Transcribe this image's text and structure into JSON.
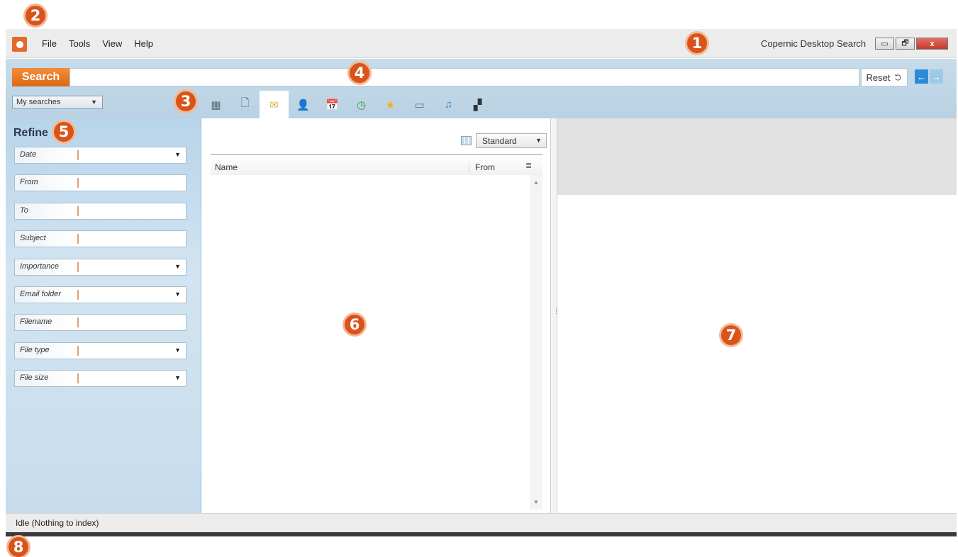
{
  "callouts": [
    "1",
    "2",
    "3",
    "4",
    "5",
    "6",
    "7",
    "8"
  ],
  "window": {
    "title": "Copernic Desktop Search",
    "minimize_glyph": "▭",
    "restore_glyph": "🗗",
    "close_glyph": "x",
    "accent": "#e36a2a"
  },
  "menu": {
    "items": [
      "File",
      "Tools",
      "View",
      "Help"
    ]
  },
  "search": {
    "label": "Search",
    "value": "",
    "placeholder": "",
    "reset_label": "Reset",
    "reset_icon": "undo-icon",
    "back_glyph": "←",
    "forward_glyph": "→"
  },
  "my_searches": {
    "selected": "My searches",
    "caret": "▼"
  },
  "category_tabs": [
    {
      "name": "all-types",
      "icon": "▦"
    },
    {
      "name": "documents",
      "icon": "🗋"
    },
    {
      "name": "emails",
      "icon": "✉"
    },
    {
      "name": "contacts",
      "icon": "👤"
    },
    {
      "name": "calendar",
      "icon": "📅"
    },
    {
      "name": "history",
      "icon": "◷"
    },
    {
      "name": "favorites",
      "icon": "★"
    },
    {
      "name": "pictures",
      "icon": "▭"
    },
    {
      "name": "music",
      "icon": "♫"
    },
    {
      "name": "videos",
      "icon": "▞"
    }
  ],
  "refine": {
    "title": "Refine",
    "fields": [
      {
        "label": "Date",
        "dropdown": "▼"
      },
      {
        "label": "From",
        "dropdown": ""
      },
      {
        "label": "To",
        "dropdown": ""
      },
      {
        "label": "Subject",
        "dropdown": ""
      },
      {
        "label": "Importance",
        "dropdown": "▼"
      },
      {
        "label": "Email folder",
        "dropdown": "▼"
      },
      {
        "label": "Filename",
        "dropdown": ""
      },
      {
        "label": "File type",
        "dropdown": "▼"
      },
      {
        "label": "File size",
        "dropdown": "▼"
      }
    ]
  },
  "results": {
    "view_mode": "Standard",
    "view_caret": "▼",
    "columns": {
      "name": "Name",
      "from": "From",
      "config_glyph": "≣"
    },
    "scroll_up": "▲",
    "scroll_down": "▼"
  },
  "splitter": {
    "grip": "⋮"
  },
  "status": {
    "text": "Idle (Nothing to index)"
  }
}
